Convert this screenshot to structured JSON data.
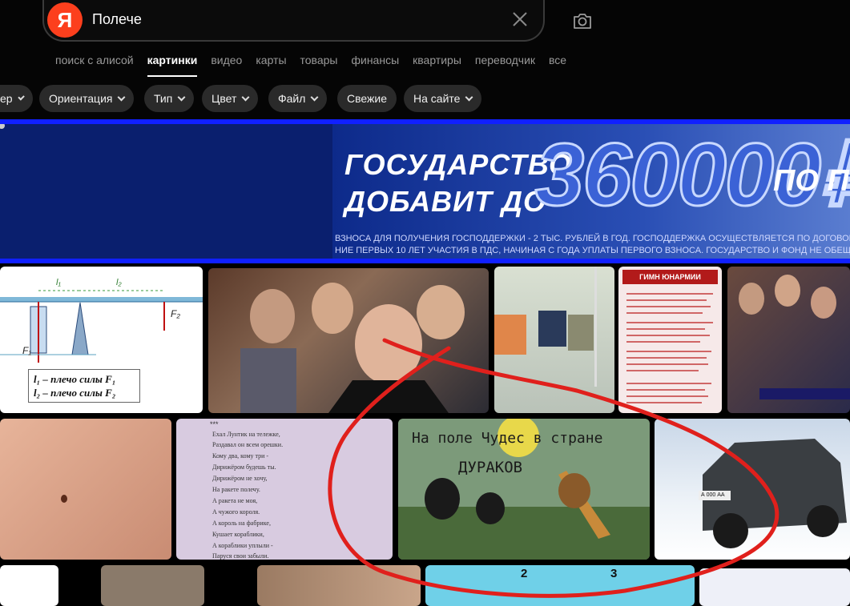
{
  "search": {
    "logo_letter": "Я",
    "query": "Полече"
  },
  "tabs": [
    {
      "label": "поиск с алисой",
      "active": false
    },
    {
      "label": "картинки",
      "active": true
    },
    {
      "label": "видео",
      "active": false
    },
    {
      "label": "карты",
      "active": false
    },
    {
      "label": "товары",
      "active": false
    },
    {
      "label": "финансы",
      "active": false
    },
    {
      "label": "квартиры",
      "active": false
    },
    {
      "label": "переводчик",
      "active": false
    },
    {
      "label": "все",
      "active": false
    }
  ],
  "filters": [
    {
      "label": "ер",
      "dropdown": true
    },
    {
      "label": "Ориентация",
      "dropdown": true
    },
    {
      "label": "Тип",
      "dropdown": true
    },
    {
      "label": "Цвет",
      "dropdown": true
    },
    {
      "label": "Файл",
      "dropdown": true
    },
    {
      "label": "Свежие",
      "dropdown": false
    },
    {
      "label": "На сайте",
      "dropdown": true
    }
  ],
  "banner": {
    "line1": "ГОСУДАРСТВО",
    "line2": "ДОБАВИТ ДО",
    "amount": "360000₽",
    "suffix": "ПО П",
    "small1": "ВЗНОСА ДЛЯ ПОЛУЧЕНИЯ ГОСПОДДЕРЖКИ - 2 ТЫС. РУБЛЕЙ В ГОД. ГОСПОДДЕРЖКА ОСУЩЕСТВЛЯЕТСЯ ПО ДОГОВОРАМ ПД",
    "small2": "НИЕ ПЕРВЫХ 10 ЛЕТ УЧАСТИЯ В ПДС, НАЧИНАЯ С ГОДА УПЛАТЫ ПЕРВОГО ВЗНОСА. ГОСУДАРСТВО И ФОНД НЕ ОБЕЩА"
  },
  "results": {
    "physics": {
      "l1": "l₁",
      "l2": "l₂",
      "f1": "F₁",
      "f2": "F₂",
      "caption1": "l₁ – плечо силы F₁",
      "caption2": "l₂ – плечо силы F₂"
    },
    "anthem_title": "ГИМН ЮНАРМИИ",
    "poem": {
      "stars": "***",
      "lines": [
        "Ехал Лунтик на тележке,",
        "Раздавал он всем орешки.",
        "Кому два, кому три -",
        "Дирижёром будешь ты.",
        "Дирижёром не хочу,",
        "На ракете полечу.",
        "А ракета не моя,",
        "А чужого короля.",
        "А король на фабрике,",
        "Кушает кораблики,",
        "А кораблики уплыли -",
        "Паруся свои забыли."
      ]
    },
    "fairy": {
      "line1": "На поле Чудес в стране",
      "line2": "ДУРАКОВ"
    },
    "panels": [
      "2",
      "3"
    ],
    "car_plate": "А 000 АА"
  },
  "colors": {
    "yandex_red": "#fc3f1d",
    "banner_blue": "#1020ff",
    "annotation_red": "#e0201c"
  }
}
